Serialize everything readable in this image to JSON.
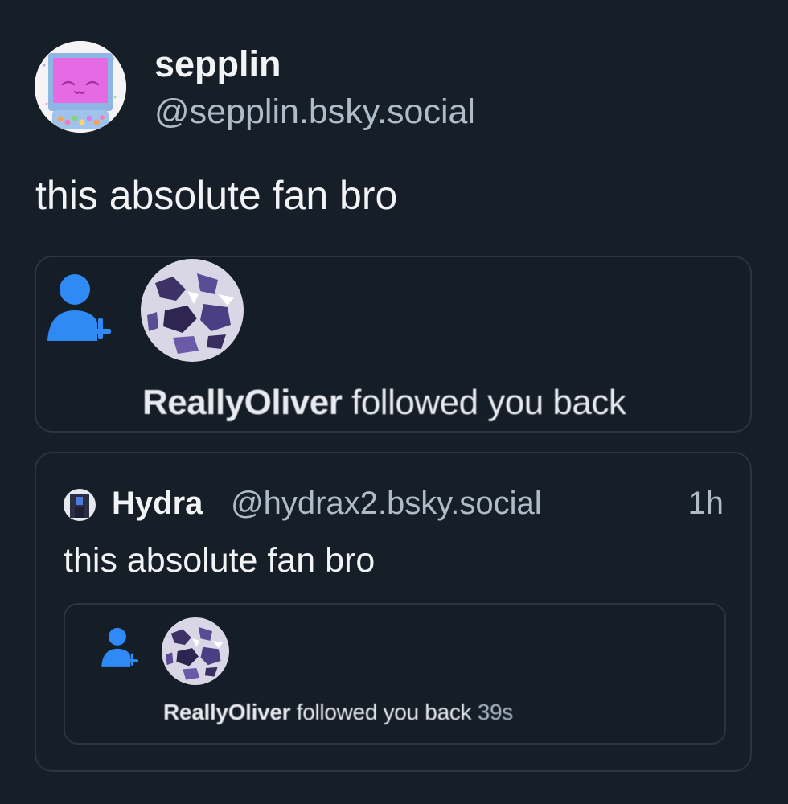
{
  "post": {
    "author": {
      "display_name": "sepplin",
      "handle": "@sepplin.bsky.social",
      "avatar_icon": "pink-tv-avatar"
    },
    "text": "this absolute fan bro",
    "embed_image": {
      "icon": "person-add-icon",
      "follower_name": "ReallyOliver",
      "action_text": " followed you back"
    },
    "quote": {
      "author": {
        "display_name": "Hydra",
        "handle": "@hydrax2.bsky.social",
        "avatar_icon": "dark-figure-avatar"
      },
      "timestamp": "1h",
      "text": "this absolute fan bro",
      "embed_image": {
        "icon": "person-add-icon",
        "follower_name": "ReallyOliver",
        "action_text": " followed you back ",
        "time": "39s"
      }
    }
  },
  "colors": {
    "background": "#161e27",
    "border": "#2b3542",
    "text_primary": "#f1f3f5",
    "text_secondary": "#aebbc9",
    "accent_blue": "#2f8af5",
    "avatar_pink": "#e569e2",
    "avatar_blue": "#7fb1e6"
  }
}
